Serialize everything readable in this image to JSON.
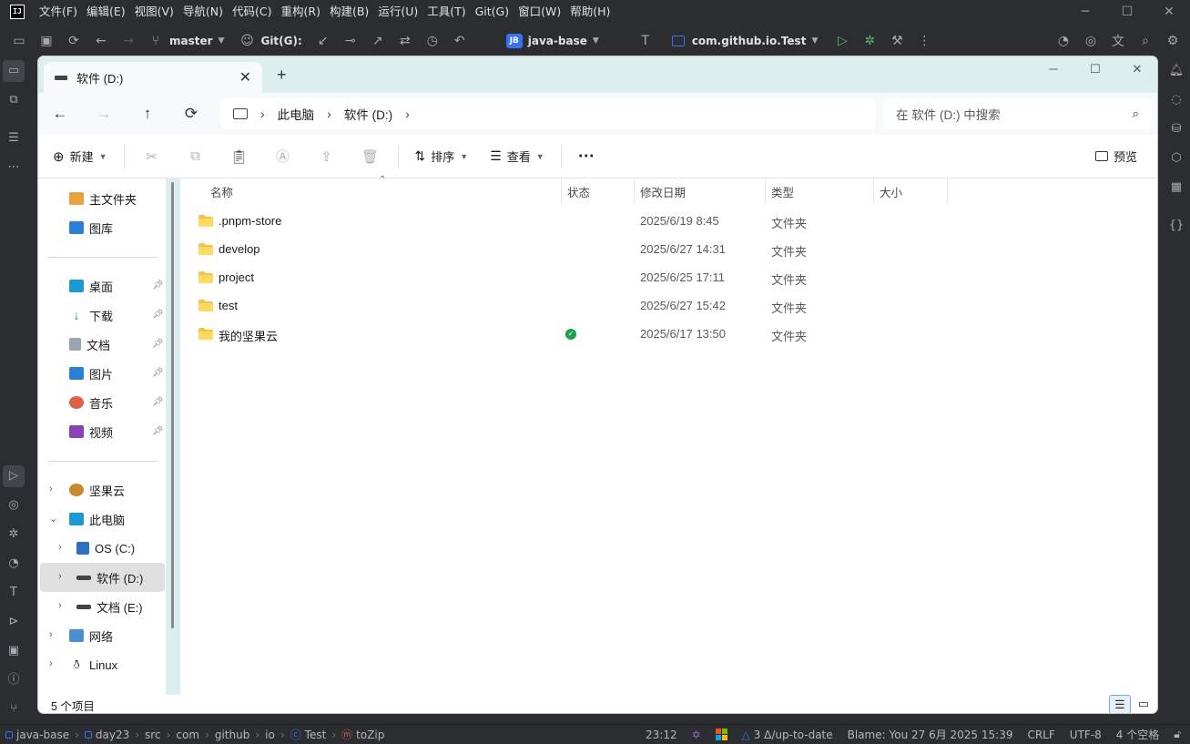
{
  "ide": {
    "menu": [
      "文件(F)",
      "编辑(E)",
      "视图(V)",
      "导航(N)",
      "代码(C)",
      "重构(R)",
      "构建(B)",
      "运行(U)",
      "工具(T)",
      "Git(G)",
      "窗口(W)",
      "帮助(H)"
    ],
    "toolbar": {
      "branch": "master",
      "git_label": "Git(G):",
      "project_badge": "JB",
      "project_name": "java-base",
      "run_config": "com.github.io.Test"
    },
    "status": {
      "breadcrumb": [
        "java-base",
        "day23",
        "src",
        "com",
        "github",
        "io",
        "Test",
        "toZip"
      ],
      "position": "23:12",
      "vcs": "3 Δ/up-to-date",
      "blame": "Blame: You 27 6月 2025 15:39",
      "line_sep": "CRLF",
      "encoding": "UTF-8",
      "indent": "4 个空格"
    }
  },
  "explorer": {
    "tab_title": "软件 (D:)",
    "address": [
      "此电脑",
      "软件 (D:)"
    ],
    "search_placeholder": "在 软件 (D:) 中搜索",
    "commands": {
      "new": "新建",
      "sort": "排序",
      "view": "查看",
      "preview": "预览"
    },
    "nav": {
      "home": "主文件夹",
      "gallery": "图库",
      "quick": [
        "桌面",
        "下载",
        "文档",
        "图片",
        "音乐",
        "视频"
      ],
      "jianguoyun": "坚果云",
      "this_pc": "此电脑",
      "drives": [
        "OS (C:)",
        "软件 (D:)",
        "文档 (E:)"
      ],
      "network": "网络",
      "linux": "Linux"
    },
    "columns": {
      "name": "名称",
      "status": "状态",
      "modified": "修改日期",
      "type": "类型",
      "size": "大小"
    },
    "files": [
      {
        "name": ".pnpm-store",
        "date": "2025/6/19 8:45",
        "type": "文件夹",
        "synced": false
      },
      {
        "name": "develop",
        "date": "2025/6/27 14:31",
        "type": "文件夹",
        "synced": false
      },
      {
        "name": "project",
        "date": "2025/6/25 17:11",
        "type": "文件夹",
        "synced": false
      },
      {
        "name": "test",
        "date": "2025/6/27 15:42",
        "type": "文件夹",
        "synced": false
      },
      {
        "name": "我的坚果云",
        "date": "2025/6/17 13:50",
        "type": "文件夹",
        "synced": true
      }
    ],
    "item_count": "5 个项目"
  },
  "colors": {
    "accent": "#3574f0",
    "folder": "#f5c342",
    "synced": "#1ea14b",
    "tab_bg": "#dceeee"
  }
}
